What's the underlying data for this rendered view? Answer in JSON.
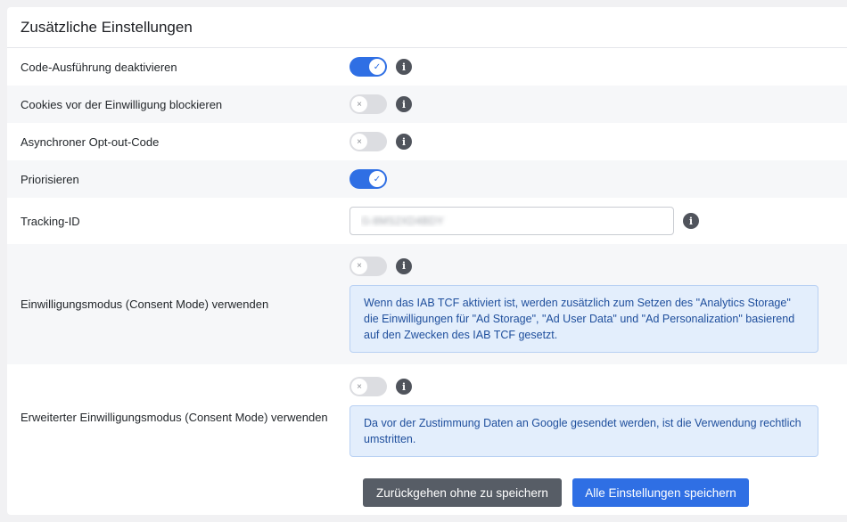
{
  "title": "Zusätzliche Einstellungen",
  "rows": [
    {
      "label": "Code-Ausführung deaktivieren",
      "enabled": true,
      "info": true
    },
    {
      "label": "Cookies vor der Einwilligung blockieren",
      "enabled": false,
      "info": true
    },
    {
      "label": "Asynchroner Opt-out-Code",
      "enabled": false,
      "info": true
    },
    {
      "label": "Priorisieren",
      "enabled": true,
      "info": false
    }
  ],
  "tracking": {
    "label": "Tracking-ID",
    "value": "G-8MS2XD4BDY"
  },
  "consent_mode": {
    "label": "Einwilligungsmodus (Consent Mode) verwenden",
    "enabled": false,
    "notice": "Wenn das IAB TCF aktiviert ist, werden zusätzlich zum Setzen des \"Analytics Storage\" die Einwilligungen für \"Ad Storage\", \"Ad User Data\" und \"Ad Personalization\" basierend auf den Zwecken des IAB TCF gesetzt."
  },
  "advanced_consent_mode": {
    "label": "Erweiterter Einwilligungsmodus (Consent Mode) verwenden",
    "enabled": false,
    "notice": "Da vor der Zustimmung Daten an Google gesendet werden, ist die Verwendung rechtlich umstritten."
  },
  "icons": {
    "check": "✓",
    "cross": "×",
    "info": "i"
  },
  "buttons": {
    "back_label": "Zurückgehen ohne zu speichern",
    "save_label": "Alle Einstellungen speichern"
  },
  "colors": {
    "accent": "#2f6fe4",
    "toggle_off": "#dcdde1",
    "notice_bg": "#e3eefc",
    "notice_text": "#1e4e9c"
  }
}
